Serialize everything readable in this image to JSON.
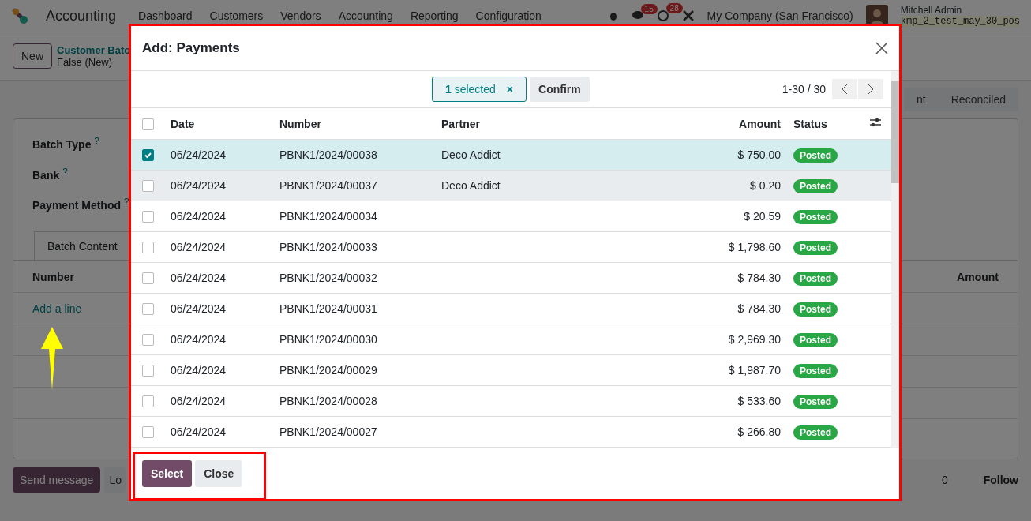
{
  "navbar": {
    "app": "Accounting",
    "menu": [
      "Dashboard",
      "Customers",
      "Vendors",
      "Accounting",
      "Reporting",
      "Configuration"
    ],
    "messages_count": "15",
    "activities_count": "28",
    "company": "My Company (San Francisco)",
    "user": "Mitchell Admin",
    "database": "kmp_2_test_may_30_pos"
  },
  "control_panel": {
    "new_button": "New",
    "breadcrumb": "Customer Batc",
    "record": "False (New)"
  },
  "stages": [
    "nt",
    "Reconciled"
  ],
  "form": {
    "fields": [
      {
        "label": "Batch Type",
        "help": "?"
      },
      {
        "label": "Bank",
        "help": "?"
      },
      {
        "label": "Payment Method",
        "help": "?"
      }
    ],
    "tab": "Batch Content",
    "columns": [
      "Number",
      "Amount"
    ],
    "add_line": "Add a line"
  },
  "chatter": {
    "send_message": "Send message",
    "log_note": "Lo",
    "followers": "0",
    "follow": "Follow"
  },
  "dialog": {
    "title": "Add: Payments",
    "selection": {
      "count": "1",
      "label": "selected",
      "clear": "×"
    },
    "confirm": "Confirm",
    "all_checked": false,
    "pager": "1-30 / 30",
    "columns": [
      "Date",
      "Number",
      "Partner",
      "Amount",
      "Status"
    ],
    "rows": [
      {
        "date": "06/24/2024",
        "number": "PBNK1/2024/00038",
        "partner": "Deco Addict",
        "amount": "$ 750.00",
        "status": "Posted",
        "checked": true,
        "selected": true,
        "hovered": false
      },
      {
        "date": "06/24/2024",
        "number": "PBNK1/2024/00037",
        "partner": "Deco Addict",
        "amount": "$ 0.20",
        "status": "Posted",
        "checked": false,
        "selected": false,
        "hovered": true
      },
      {
        "date": "06/24/2024",
        "number": "PBNK1/2024/00034",
        "partner": "",
        "amount": "$ 20.59",
        "status": "Posted",
        "checked": false,
        "selected": false,
        "hovered": false
      },
      {
        "date": "06/24/2024",
        "number": "PBNK1/2024/00033",
        "partner": "",
        "amount": "$ 1,798.60",
        "status": "Posted",
        "checked": false,
        "selected": false,
        "hovered": false
      },
      {
        "date": "06/24/2024",
        "number": "PBNK1/2024/00032",
        "partner": "",
        "amount": "$ 784.30",
        "status": "Posted",
        "checked": false,
        "selected": false,
        "hovered": false
      },
      {
        "date": "06/24/2024",
        "number": "PBNK1/2024/00031",
        "partner": "",
        "amount": "$ 784.30",
        "status": "Posted",
        "checked": false,
        "selected": false,
        "hovered": false
      },
      {
        "date": "06/24/2024",
        "number": "PBNK1/2024/00030",
        "partner": "",
        "amount": "$ 2,969.30",
        "status": "Posted",
        "checked": false,
        "selected": false,
        "hovered": false
      },
      {
        "date": "06/24/2024",
        "number": "PBNK1/2024/00029",
        "partner": "",
        "amount": "$ 1,987.70",
        "status": "Posted",
        "checked": false,
        "selected": false,
        "hovered": false
      },
      {
        "date": "06/24/2024",
        "number": "PBNK1/2024/00028",
        "partner": "",
        "amount": "$ 533.60",
        "status": "Posted",
        "checked": false,
        "selected": false,
        "hovered": false
      },
      {
        "date": "06/24/2024",
        "number": "PBNK1/2024/00027",
        "partner": "",
        "amount": "$ 266.80",
        "status": "Posted",
        "checked": false,
        "selected": false,
        "hovered": false
      }
    ],
    "buttons": [
      {
        "label": "Select",
        "kind": "primary"
      },
      {
        "label": "Close",
        "kind": "secondary"
      }
    ]
  }
}
